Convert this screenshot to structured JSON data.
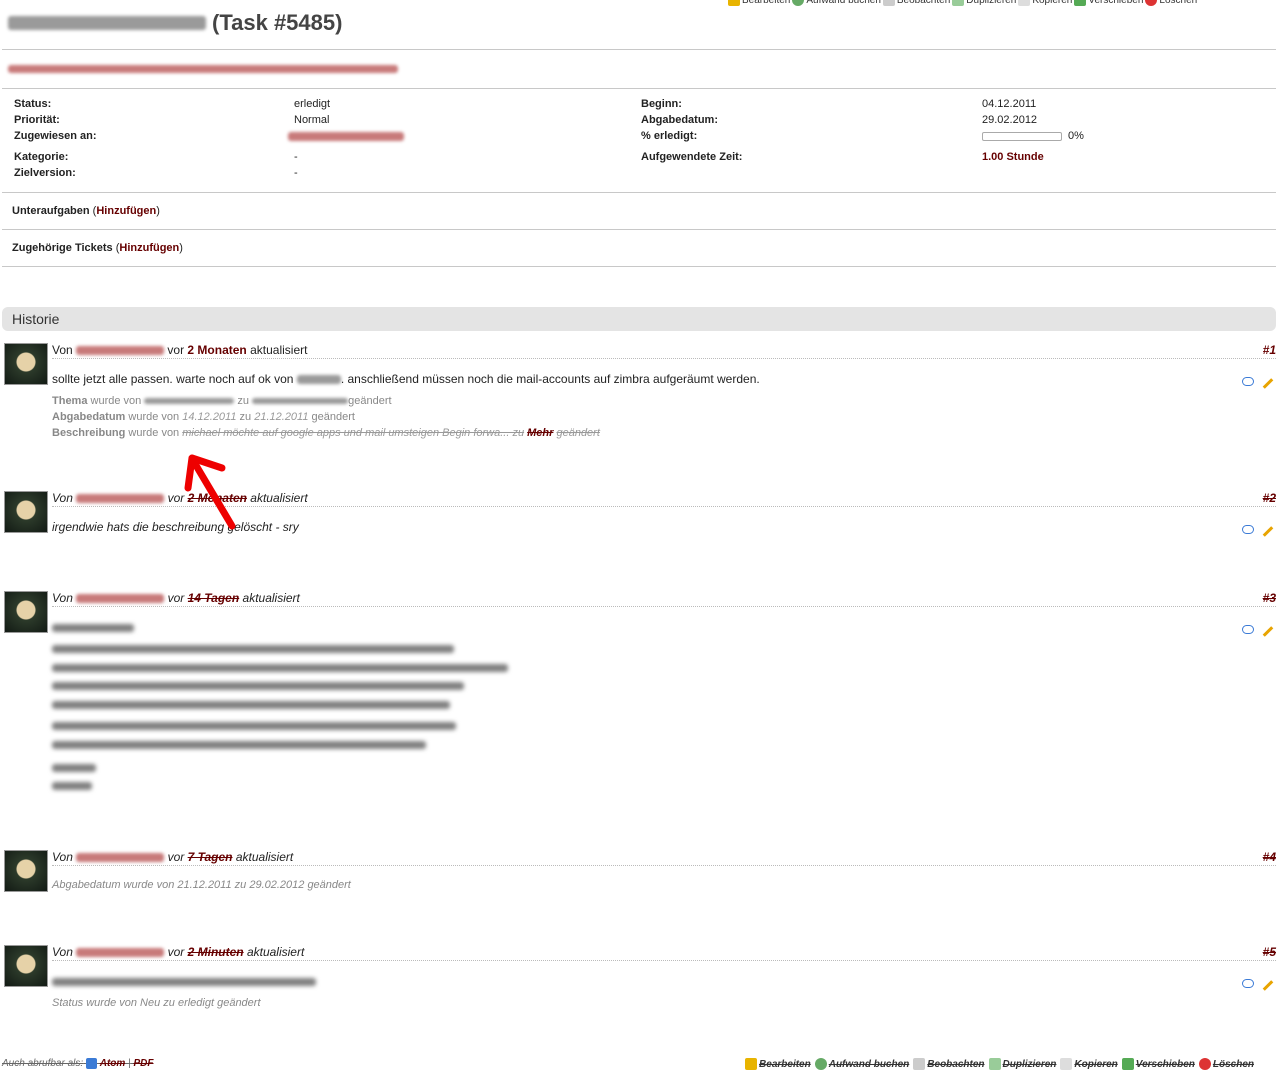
{
  "actions": [
    {
      "label": "Bearbeiten",
      "icon": "pencil-icon"
    },
    {
      "label": "Aufwand buchen",
      "icon": "clock-icon"
    },
    {
      "label": "Beobachten",
      "icon": "star-icon"
    },
    {
      "label": "Duplizieren",
      "icon": "duplicate-icon"
    },
    {
      "label": "Kopieren",
      "icon": "copy-icon"
    },
    {
      "label": "Verschieben",
      "icon": "move-icon"
    },
    {
      "label": "Löschen",
      "icon": "delete-icon"
    }
  ],
  "issue": {
    "title_suffix": "(Task #5485)"
  },
  "attributes": {
    "status_label": "Status:",
    "status": "erledigt",
    "priority_label": "Priorität:",
    "priority": "Normal",
    "assigned_label": "Zugewiesen an:",
    "category_label": "Kategorie:",
    "category": "-",
    "version_label": "Zielversion:",
    "version": "-",
    "start_label": "Beginn:",
    "start": "04.12.2011",
    "due_label": "Abgabedatum:",
    "due": "29.02.2012",
    "done_label": "% erledigt:",
    "done": "0%",
    "done_fraction": 0,
    "spent_label": "Aufgewendete Zeit:",
    "spent": "1.00 Stunde"
  },
  "subtasks": {
    "label": "Unteraufgaben",
    "link": "Hinzufügen"
  },
  "relations": {
    "label": "Zugehörige Tickets",
    "link": "Hinzufügen"
  },
  "history": {
    "heading": "Historie",
    "entries": [
      {
        "von": "Von",
        "vor": "vor",
        "ago": "2 Monaten",
        "updated": "aktualisiert",
        "num": "#1",
        "text": "sollte jetzt alle passen. warte noch auf ok von",
        "text2": ". anschließend müssen noch die mail-accounts auf zimbra aufgeräumt werden.",
        "d1_field": "Thema",
        "d1_from": "wurde von",
        "d1_to": "zu",
        "d1_end": "geändert",
        "d2_field": "Abgabedatum",
        "d2_from": "wurde von",
        "d2_old": "14.12.2011",
        "d2_to": "zu",
        "d2_new": "21.12.2011",
        "d2_end": "geändert",
        "d3_field": "Beschreibung",
        "d3_from": "wurde von",
        "d3_old": "michael möchte auf google apps und mail umsteigen Begin forwa... zu",
        "d3_more": "Mehr",
        "d3_end": "geändert"
      },
      {
        "von": "Von",
        "vor": "vor",
        "ago": "2 Monaten",
        "updated": "aktualisiert",
        "num": "#2",
        "text": "irgendwie hats die beschreibung gelöscht - sry"
      },
      {
        "von": "Von",
        "vor": "vor",
        "ago": "14 Tagen",
        "updated": "aktualisiert",
        "num": "#3"
      },
      {
        "von": "Von",
        "vor": "vor",
        "ago": "7 Tagen",
        "updated": "aktualisiert",
        "num": "#4",
        "detail": "Abgabedatum wurde von 21.12.2011 zu 29.02.2012 geändert"
      },
      {
        "von": "Von",
        "vor": "vor",
        "ago": "2 Minuten",
        "updated": "aktualisiert",
        "num": "#5",
        "detail": "Status wurde von Neu zu erledigt geändert"
      }
    ]
  },
  "footer": {
    "also": "Auch abrufbar als:",
    "atom": "Atom",
    "sep": "|",
    "pdf": "PDF"
  }
}
